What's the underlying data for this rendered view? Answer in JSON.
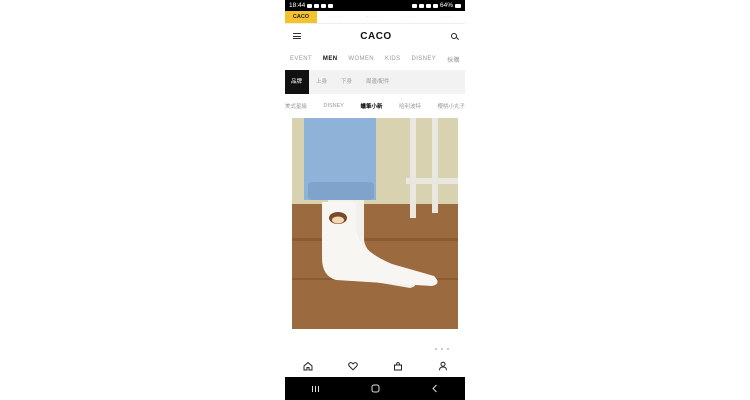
{
  "status_bar": {
    "time": "18:44",
    "battery": "64%"
  },
  "brand_tabs": [
    {
      "label": "CACO",
      "active": true
    },
    {
      "label": "· · · ·",
      "active": false
    },
    {
      "label": "· · · ·",
      "active": false
    },
    {
      "label": "· · ·",
      "active": false
    },
    {
      "label": "· · · ·",
      "active": false
    }
  ],
  "header": {
    "logo": "CACO"
  },
  "nav_tabs": [
    {
      "label": "EVENT",
      "active": false
    },
    {
      "label": "MEN",
      "active": true
    },
    {
      "label": "WOMEN",
      "active": false
    },
    {
      "label": "KIDS",
      "active": false
    },
    {
      "label": "DISNEY",
      "active": false
    },
    {
      "label": "採購",
      "active": false
    }
  ],
  "category_bar": [
    {
      "label": "品牌",
      "active": true
    },
    {
      "label": "上身",
      "active": false
    },
    {
      "label": "下身",
      "active": false
    },
    {
      "label": "周邊/配件",
      "active": false
    }
  ],
  "sub_tabs": [
    {
      "label": "美式星級",
      "active": false
    },
    {
      "label": "DISNEY",
      "active": false
    },
    {
      "label": "蠟筆小新",
      "active": true
    },
    {
      "label": "哈利波特",
      "active": false
    },
    {
      "label": "櫻桃小丸子",
      "active": false
    }
  ],
  "bottom_nav": [
    "home-icon",
    "heart-icon",
    "bag-icon",
    "user-icon"
  ],
  "colors": {
    "accent": "#f4c22c",
    "floor": "#9c6a3f",
    "jeans": "#8fb2d8"
  }
}
